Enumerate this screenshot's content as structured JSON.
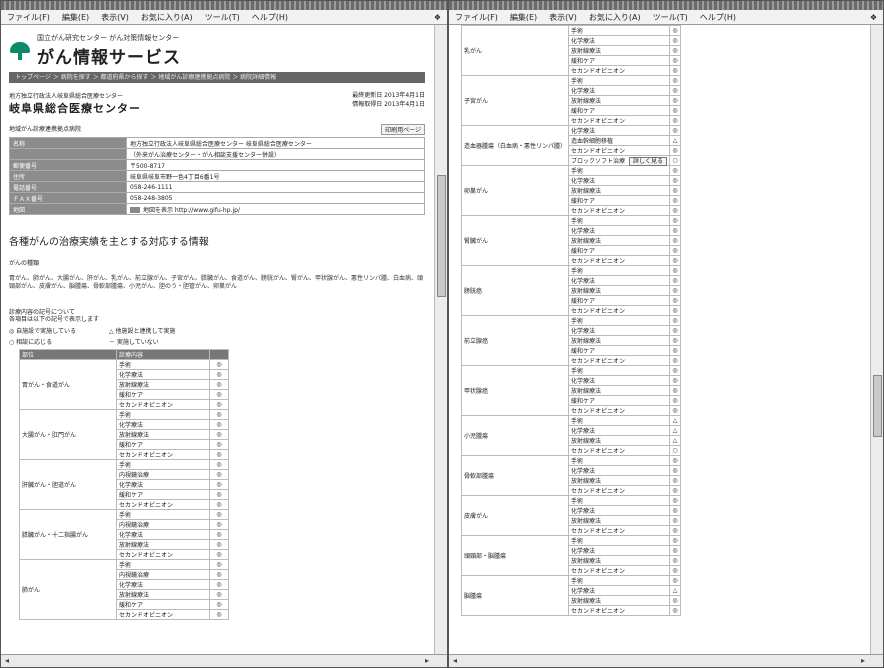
{
  "menu": {
    "items": [
      "ファイル(F)",
      "編集(E)",
      "表示(V)",
      "お気に入り(A)",
      "ツール(T)",
      "ヘルプ(H)"
    ]
  },
  "left": {
    "logo_small": "国立がん研究センター がん対策情報センター",
    "logo_big": "がん情報サービス",
    "navbar_text": "トップページ ＞ 病院を探す ＞ 都道府県から探す ＞ 地域がん診療連携拠点病院 ＞ 病院詳細情報",
    "org_line": "地方独立行政法人岐阜県総合医療センター",
    "hospital_name": "岐阜県総合医療センター",
    "updated": [
      "最終更新日 2013年4月1日",
      "情報取得日 2013年4月1日"
    ],
    "section_title": "地域がん診療連携拠点病院",
    "print_button": "印刷用ページ",
    "info_rows": [
      {
        "k": "名称",
        "v": "地方独立行政法人岐阜県総合医療センター 岐阜県総合医療センター"
      },
      {
        "k": "",
        "v": "（外来がん治療センター・がん相談支援センター併設）"
      },
      {
        "k": "郵便番号",
        "v": "〒500-8717"
      },
      {
        "k": "住所",
        "v": "岐阜県岐阜市野一色4丁目6番1号"
      },
      {
        "k": "電話番号",
        "v": "058-246-1111"
      },
      {
        "k": "ＦＡＸ番号",
        "v": "058-248-3805"
      },
      {
        "k": "地図",
        "v": "地図を表示 http://www.gifu-hp.jp/"
      }
    ],
    "heading": "各種がんの治療実績を主とする対応する情報",
    "subheading": "がんの種類",
    "para": "胃がん、肺がん、大腸がん、肝がん、乳がん、前立腺がん、子宮がん、膵臓がん、食道がん、膀胱がん、腎がん、甲状腺がん、悪性リンパ腫、白血病、頭頸部がん、皮膚がん、脳腫瘍、骨軟部腫瘍、小児がん、胆のう・胆管がん、卵巣がん",
    "legend_title": [
      "診療内容の記号について",
      "各項目は以下の記号で表示します"
    ],
    "legend": [
      "◎ 自施設で実施している",
      "△ 他施設と連携して実施",
      "○ 相談に応じる",
      "－ 実施していない"
    ],
    "grid_header": [
      "部位",
      "診療内容",
      ""
    ],
    "grid": [
      {
        "cat": "胃がん・食道がん",
        "rows": [
          [
            "手術",
            "◎"
          ],
          [
            "化学療法",
            "◎"
          ],
          [
            "放射線療法",
            "◎"
          ],
          [
            "緩和ケア",
            "◎"
          ],
          [
            "セカンドオピニオン",
            "◎"
          ]
        ]
      },
      {
        "cat": "大腸がん・肛門がん",
        "rows": [
          [
            "手術",
            "◎"
          ],
          [
            "化学療法",
            "◎"
          ],
          [
            "放射線療法",
            "◎"
          ],
          [
            "緩和ケア",
            "◎"
          ],
          [
            "セカンドオピニオン",
            "◎"
          ]
        ]
      },
      {
        "cat": "肝臓がん・胆道がん",
        "rows": [
          [
            "手術",
            "◎"
          ],
          [
            "内視鏡治療",
            "◎"
          ],
          [
            "化学療法",
            "◎"
          ],
          [
            "緩和ケア",
            "◎"
          ],
          [
            "セカンドオピニオン",
            "◎"
          ]
        ]
      },
      {
        "cat": "膵臓がん・十二指腸がん",
        "rows": [
          [
            "手術",
            "◎"
          ],
          [
            "内視鏡治療",
            "◎"
          ],
          [
            "化学療法",
            "◎"
          ],
          [
            "放射線療法",
            "◎"
          ],
          [
            "セカンドオピニオン",
            "◎"
          ]
        ]
      },
      {
        "cat": "肺がん",
        "rows": [
          [
            "手術",
            "◎"
          ],
          [
            "内視鏡治療",
            "◎"
          ],
          [
            "化学療法",
            "◎"
          ],
          [
            "放射線療法",
            "◎"
          ],
          [
            "緩和ケア",
            "◎"
          ],
          [
            "セカンドオピニオン",
            "◎"
          ]
        ]
      }
    ]
  },
  "right": {
    "grid": [
      {
        "cat": "乳がん",
        "rows": [
          [
            "手術",
            "◎"
          ],
          [
            "化学療法",
            "◎"
          ],
          [
            "放射線療法",
            "◎"
          ],
          [
            "緩和ケア",
            "◎"
          ],
          [
            "セカンドオピニオン",
            "◎"
          ]
        ]
      },
      {
        "cat": "子宮がん",
        "rows": [
          [
            "手術",
            "◎"
          ],
          [
            "化学療法",
            "◎"
          ],
          [
            "放射線療法",
            "◎"
          ],
          [
            "緩和ケア",
            "◎"
          ],
          [
            "セカンドオピニオン",
            "◎"
          ]
        ]
      },
      {
        "cat": "造血器腫瘍（白血病・悪性リンパ腫）",
        "rows": [
          [
            "化学療法",
            "◎"
          ],
          [
            "造血幹細胞移植",
            "△"
          ],
          [
            "セカンドオピニオン",
            "◎"
          ],
          [
            "ブロックソフト治療",
            "○"
          ]
        ],
        "badge": "詳しく見る"
      },
      {
        "cat": "卵巣がん",
        "rows": [
          [
            "手術",
            "◎"
          ],
          [
            "化学療法",
            "◎"
          ],
          [
            "放射線療法",
            "◎"
          ],
          [
            "緩和ケア",
            "◎"
          ],
          [
            "セカンドオピニオン",
            "◎"
          ]
        ]
      },
      {
        "cat": "腎臓がん",
        "rows": [
          [
            "手術",
            "◎"
          ],
          [
            "化学療法",
            "◎"
          ],
          [
            "放射線療法",
            "◎"
          ],
          [
            "緩和ケア",
            "◎"
          ],
          [
            "セカンドオピニオン",
            "◎"
          ]
        ]
      },
      {
        "cat": "膀胱癌",
        "rows": [
          [
            "手術",
            "◎"
          ],
          [
            "化学療法",
            "◎"
          ],
          [
            "放射線療法",
            "◎"
          ],
          [
            "緩和ケア",
            "◎"
          ],
          [
            "セカンドオピニオン",
            "◎"
          ]
        ]
      },
      {
        "cat": "前立腺癌",
        "rows": [
          [
            "手術",
            "◎"
          ],
          [
            "化学療法",
            "◎"
          ],
          [
            "放射線療法",
            "◎"
          ],
          [
            "緩和ケア",
            "◎"
          ],
          [
            "セカンドオピニオン",
            "◎"
          ]
        ]
      },
      {
        "cat": "甲状腺癌",
        "rows": [
          [
            "手術",
            "◎"
          ],
          [
            "化学療法",
            "◎"
          ],
          [
            "放射線療法",
            "◎"
          ],
          [
            "緩和ケア",
            "◎"
          ],
          [
            "セカンドオピニオン",
            "◎"
          ]
        ]
      },
      {
        "cat": "小児腫瘍",
        "rows": [
          [
            "手術",
            "△"
          ],
          [
            "化学療法",
            "△"
          ],
          [
            "放射線療法",
            "△"
          ],
          [
            "セカンドオピニオン",
            "○"
          ]
        ]
      },
      {
        "cat": "骨軟部腫瘍",
        "rows": [
          [
            "手術",
            "◎"
          ],
          [
            "化学療法",
            "◎"
          ],
          [
            "放射線療法",
            "◎"
          ],
          [
            "セカンドオピニオン",
            "◎"
          ]
        ]
      },
      {
        "cat": "皮膚がん",
        "rows": [
          [
            "手術",
            "◎"
          ],
          [
            "化学療法",
            "◎"
          ],
          [
            "放射線療法",
            "◎"
          ],
          [
            "セカンドオピニオン",
            "◎"
          ]
        ]
      },
      {
        "cat": "頭頸部・脳腫瘍",
        "rows": [
          [
            "手術",
            "◎"
          ],
          [
            "化学療法",
            "◎"
          ],
          [
            "放射線療法",
            "◎"
          ],
          [
            "セカンドオピニオン",
            "◎"
          ]
        ]
      },
      {
        "cat": "脳腫瘍",
        "rows": [
          [
            "手術",
            "◎"
          ],
          [
            "化学療法",
            "△"
          ],
          [
            "放射線療法",
            "◎"
          ],
          [
            "セカンドオピニオン",
            "◎"
          ]
        ]
      }
    ]
  }
}
